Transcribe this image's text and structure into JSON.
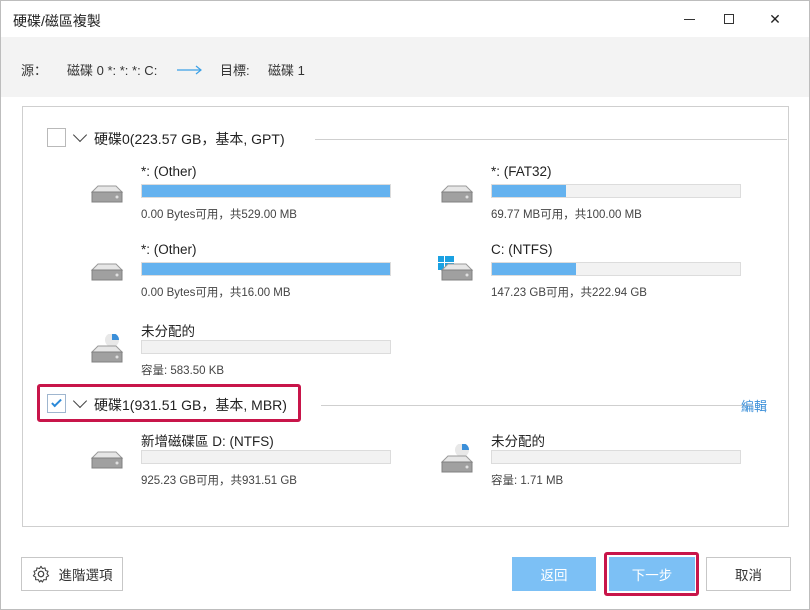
{
  "window": {
    "title": "硬碟/磁區複製",
    "minimize_icon": "minimize-icon",
    "maximize_icon": "maximize-icon",
    "close_label": "✕"
  },
  "summary": {
    "source_label": "源：",
    "source_value": "磁碟 0 *: *: *: C:",
    "target_label": "目標:",
    "target_value": "磁碟 1",
    "arrow_color": "#3ba0e6"
  },
  "disks": [
    {
      "label": "硬碟0(223.57 GB，基本, GPT)",
      "checked": false,
      "edit_label": "",
      "partitions": [
        {
          "name": "*: (Other)",
          "info": "0.00 Bytes可用，共529.00 MB",
          "fill": 1.0,
          "icon": "drive-icon"
        },
        {
          "name": "*: (FAT32)",
          "info": "69.77 MB可用，共100.00 MB",
          "fill": 0.3,
          "icon": "drive-icon"
        },
        {
          "name": "*: (Other)",
          "info": "0.00 Bytes可用，共16.00 MB",
          "fill": 1.0,
          "icon": "drive-icon"
        },
        {
          "name": "C: (NTFS)",
          "info": "147.23 GB可用，共222.94 GB",
          "fill": 0.34,
          "icon": "windows-drive-icon"
        },
        {
          "name": "未分配的",
          "info": "容量: 583.50 KB",
          "fill": 0.0,
          "icon": "unallocated-drive-icon"
        }
      ]
    },
    {
      "label": "硬碟1(931.51 GB，基本, MBR)",
      "checked": true,
      "edit_label": "編輯",
      "partitions": [
        {
          "name": "新增磁碟區 D: (NTFS)",
          "info": "925.23 GB可用，共931.51 GB",
          "fill": 0.0,
          "icon": "drive-icon"
        },
        {
          "name": "未分配的",
          "info": "容量: 1.71 MB",
          "fill": 0.0,
          "icon": "unallocated-drive-icon"
        }
      ]
    }
  ],
  "footer": {
    "advanced_label": "進階選項",
    "back_label": "返回",
    "next_label": "下一步",
    "cancel_label": "取消"
  },
  "colors": {
    "accent": "#64b2ef",
    "primary_button": "#7cc0f5",
    "highlight": "#c8154a",
    "link": "#3b8fd9"
  }
}
